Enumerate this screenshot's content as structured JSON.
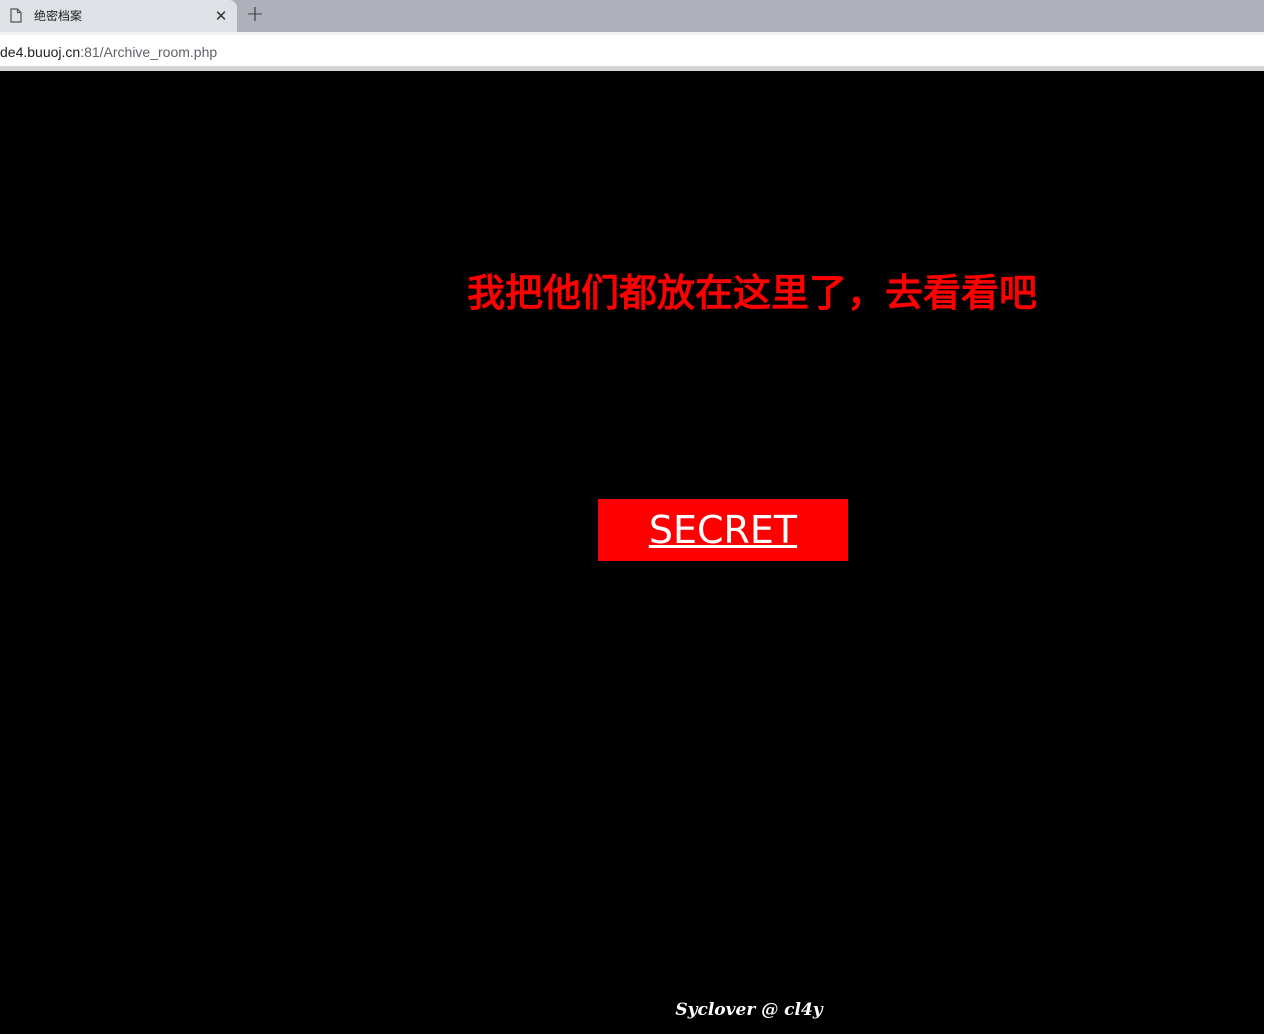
{
  "browser": {
    "tab": {
      "title": "绝密档案",
      "close_label": "✕",
      "icon": "page-icon"
    },
    "new_tab_label": "+",
    "address_bar": {
      "host": "de4.buuoj.cn",
      "rest": ":81/Archive_room.php"
    }
  },
  "page": {
    "headline": "我把他们都放在这里了，去看看吧",
    "secret_link_label": "SECRET",
    "footer": "Syclover @ cl4y"
  },
  "colors": {
    "background": "#000000",
    "headline": "#ff0000",
    "button_bg": "#ff0000",
    "button_text": "#ffffff",
    "footer": "#ffffff"
  }
}
